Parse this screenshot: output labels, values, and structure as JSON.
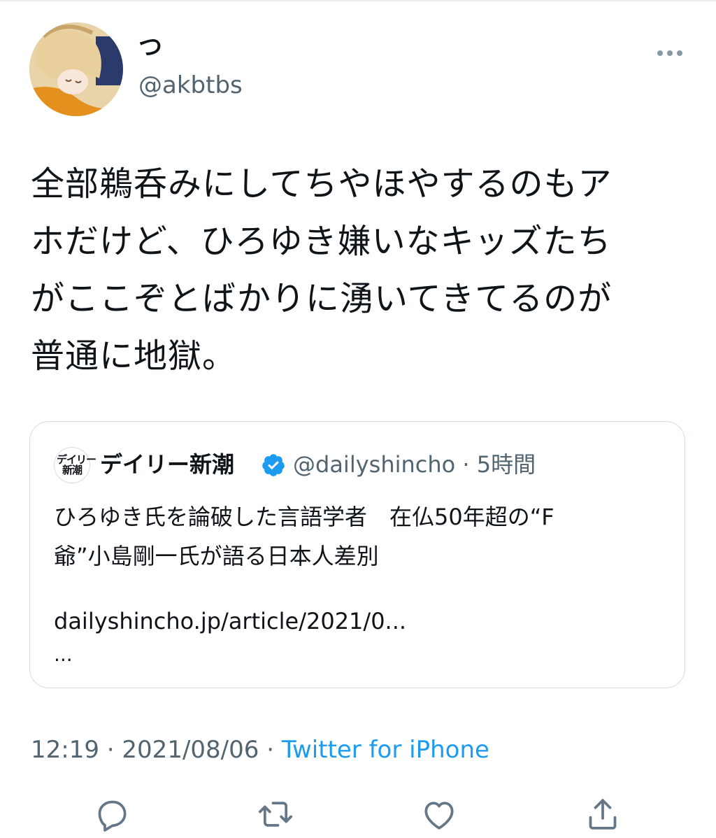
{
  "tweet": {
    "display_name": "つ",
    "handle": "@akbtbs",
    "text": "全部鵜呑みにしてちやほやするのもア\nホだけど、ひろゆき嫌いなキッズたち\nがここぞとばかりに湧いてきてるのが\n普通に地獄。",
    "time": "12:19",
    "date": "2021/08/06",
    "source": "Twitter for iPhone"
  },
  "quote": {
    "avatar_text": "デイリー\n新潮",
    "name": "デイリー新潮",
    "handle": "@dailyshincho",
    "age": "5時間",
    "text": "ひろゆき氏を論破した言語学者　在仏50年超の“F\n爺”小島剛一氏が語る日本人差別",
    "link": "dailyshincho.jp/article/2021/0...",
    "ellipsis": "..."
  },
  "icons": [
    "more-icon",
    "verified-icon",
    "reply-icon",
    "retweet-icon",
    "like-icon",
    "share-icon"
  ],
  "colors": {
    "accent": "#1d9bf0",
    "secondary_text": "#536471",
    "icon": "#657786"
  }
}
